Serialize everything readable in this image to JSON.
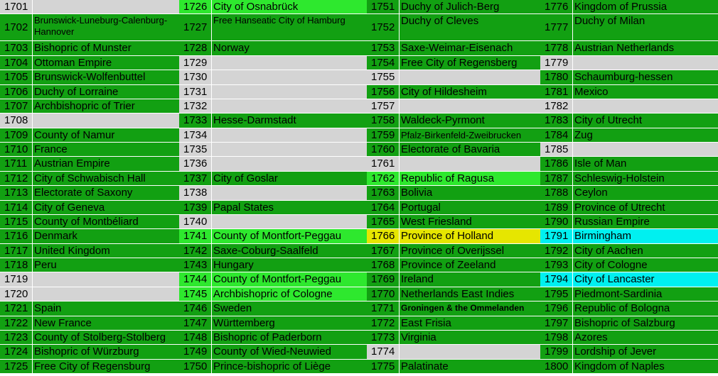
{
  "columns": [
    [
      {
        "num": "1701",
        "name": "",
        "color": "w"
      },
      {
        "num": "1702",
        "name": "Brunswick-Luneburg-Calenburg-Hannover",
        "color": "g",
        "tall": true
      },
      {
        "num": "1703",
        "name": "Bishopric of Munster",
        "color": "g"
      },
      {
        "num": "1704",
        "name": "Ottoman Empire",
        "color": "g"
      },
      {
        "num": "1705",
        "name": "Brunswick-Wolfenbuttel",
        "color": "g"
      },
      {
        "num": "1706",
        "name": "Duchy of Lorraine",
        "color": "g"
      },
      {
        "num": "1707",
        "name": "Archbishopric of Trier",
        "color": "g"
      },
      {
        "num": "1708",
        "name": "",
        "color": "w"
      },
      {
        "num": "1709",
        "name": "County of Namur",
        "color": "g"
      },
      {
        "num": "1710",
        "name": "France",
        "color": "g"
      },
      {
        "num": "1711",
        "name": "Austrian Empire",
        "color": "g"
      },
      {
        "num": "1712",
        "name": "City of Schwabisch Hall",
        "color": "g"
      },
      {
        "num": "1713",
        "name": "Electorate of Saxony",
        "color": "g"
      },
      {
        "num": "1714",
        "name": "City of Geneva",
        "color": "g"
      },
      {
        "num": "1715",
        "name": "County of Montbéliard",
        "color": "g"
      },
      {
        "num": "1716",
        "name": "Denmark",
        "color": "g"
      },
      {
        "num": "1717",
        "name": "United Kingdom",
        "color": "g"
      },
      {
        "num": "1718",
        "name": "Peru",
        "color": "g"
      },
      {
        "num": "1719",
        "name": "",
        "color": "w"
      },
      {
        "num": "1720",
        "name": "",
        "color": "w"
      },
      {
        "num": "1721",
        "name": "Spain",
        "color": "g"
      },
      {
        "num": "1722",
        "name": "New France",
        "color": "g"
      },
      {
        "num": "1723",
        "name": "County of Stolberg-Stolberg",
        "color": "g"
      },
      {
        "num": "1724",
        "name": "Bishopric of Würzburg",
        "color": "g"
      },
      {
        "num": "1725",
        "name": "Free City of Regensburg",
        "color": "g"
      }
    ],
    [
      {
        "num": "1726",
        "name": "City of Osnabrück",
        "color": "lg"
      },
      {
        "num": "1727",
        "name": "Free Hanseatic City of Hamburg",
        "color": "g",
        "tall": true
      },
      {
        "num": "1728",
        "name": "Norway",
        "color": "g"
      },
      {
        "num": "1729",
        "name": "",
        "color": "w"
      },
      {
        "num": "1730",
        "name": "",
        "color": "w"
      },
      {
        "num": "1731",
        "name": "",
        "color": "w"
      },
      {
        "num": "1732",
        "name": "",
        "color": "w"
      },
      {
        "num": "1733",
        "name": "Hesse-Darmstadt",
        "color": "g"
      },
      {
        "num": "1734",
        "name": "",
        "color": "w"
      },
      {
        "num": "1735",
        "name": "",
        "color": "w"
      },
      {
        "num": "1736",
        "name": "",
        "color": "w"
      },
      {
        "num": "1737",
        "name": "City of Goslar",
        "color": "g"
      },
      {
        "num": "1738",
        "name": "",
        "color": "w"
      },
      {
        "num": "1739",
        "name": "Papal States",
        "color": "g"
      },
      {
        "num": "1740",
        "name": "",
        "color": "w"
      },
      {
        "num": "1741",
        "name": "County of Montfort-Peggau",
        "color": "lg"
      },
      {
        "num": "1742",
        "name": "Saxe-Coburg-Saalfeld",
        "color": "g"
      },
      {
        "num": "1743",
        "name": "Hungary",
        "color": "g"
      },
      {
        "num": "1744",
        "name": "County of Montfort-Peggau",
        "color": "lg"
      },
      {
        "num": "1745",
        "name": "Archbishopric of Cologne",
        "color": "lg"
      },
      {
        "num": "1746",
        "name": "Sweden",
        "color": "g"
      },
      {
        "num": "1747",
        "name": "Württemberg",
        "color": "g"
      },
      {
        "num": "1748",
        "name": "Bishopric of Paderborn",
        "color": "g"
      },
      {
        "num": "1749",
        "name": "County of Wied-Neuwied",
        "color": "g"
      },
      {
        "num": "1750",
        "name": "Prince-bishopric of Liège",
        "color": "g"
      }
    ],
    [
      {
        "num": "1751",
        "name": "Duchy of Julich-Berg",
        "color": "g"
      },
      {
        "num": "1752",
        "name": "Duchy of Cleves",
        "color": "g",
        "tall": true
      },
      {
        "num": "1753",
        "name": "Saxe-Weimar-Eisenach",
        "color": "g"
      },
      {
        "num": "1754",
        "name": "Free City of Regensberg",
        "color": "g"
      },
      {
        "num": "1755",
        "name": "",
        "color": "w"
      },
      {
        "num": "1756",
        "name": "City of Hildesheim",
        "color": "g"
      },
      {
        "num": "1757",
        "name": "",
        "color": "w"
      },
      {
        "num": "1758",
        "name": "Waldeck-Pyrmont",
        "color": "g"
      },
      {
        "num": "1759",
        "name": "Pfalz-Birkenfeld-Zweibrucken",
        "color": "g",
        "tight": true
      },
      {
        "num": "1760",
        "name": "Electorate of Bavaria",
        "color": "g"
      },
      {
        "num": "1761",
        "name": "",
        "color": "w"
      },
      {
        "num": "1762",
        "name": "Republic of Ragusa",
        "color": "lg"
      },
      {
        "num": "1763",
        "name": "Bolivia",
        "color": "g"
      },
      {
        "num": "1764",
        "name": "Portugal",
        "color": "g"
      },
      {
        "num": "1765",
        "name": "West Friesland",
        "color": "g"
      },
      {
        "num": "1766",
        "name": "Province of Holland",
        "color": "y"
      },
      {
        "num": "1767",
        "name": "Province of Overijssel",
        "color": "g"
      },
      {
        "num": "1768",
        "name": "Province of Zeeland",
        "color": "g"
      },
      {
        "num": "1769",
        "name": "Ireland",
        "color": "g"
      },
      {
        "num": "1770",
        "name": "Netherlands East Indies",
        "color": "g"
      },
      {
        "num": "1771",
        "name": "Groningen & the Ommelanden",
        "color": "g",
        "small": true
      },
      {
        "num": "1772",
        "name": "East Frisia",
        "color": "g"
      },
      {
        "num": "1773",
        "name": "Virginia",
        "color": "g"
      },
      {
        "num": "1774",
        "name": "",
        "color": "w"
      },
      {
        "num": "1775",
        "name": "Palatinate",
        "color": "g"
      }
    ],
    [
      {
        "num": "1776",
        "name": "Kingdom of Prussia",
        "color": "g"
      },
      {
        "num": "1777",
        "name": "Duchy of Milan",
        "color": "g",
        "tall": true
      },
      {
        "num": "1778",
        "name": "Austrian Netherlands",
        "color": "g"
      },
      {
        "num": "1779",
        "name": "",
        "color": "w"
      },
      {
        "num": "1780",
        "name": "Schaumburg-hessen",
        "color": "g"
      },
      {
        "num": "1781",
        "name": "Mexico",
        "color": "g"
      },
      {
        "num": "1782",
        "name": "",
        "color": "w"
      },
      {
        "num": "1783",
        "name": "City of Utrecht",
        "color": "g"
      },
      {
        "num": "1784",
        "name": "Zug",
        "color": "g"
      },
      {
        "num": "1785",
        "name": "",
        "color": "w"
      },
      {
        "num": "1786",
        "name": "Isle of Man",
        "color": "g"
      },
      {
        "num": "1787",
        "name": "Schleswig-Holstein",
        "color": "g"
      },
      {
        "num": "1788",
        "name": "Ceylon",
        "color": "g"
      },
      {
        "num": "1789",
        "name": "Province of Utrecht",
        "color": "g"
      },
      {
        "num": "1790",
        "name": "Russian Empire",
        "color": "g"
      },
      {
        "num": "1791",
        "name": "Birmingham",
        "color": "c"
      },
      {
        "num": "1792",
        "name": "City of Aachen",
        "color": "g"
      },
      {
        "num": "1793",
        "name": "City of Cologne",
        "color": "g"
      },
      {
        "num": "1794",
        "name": "City of Lancaster",
        "color": "c"
      },
      {
        "num": "1795",
        "name": "Piedmont-Sardinia",
        "color": "g"
      },
      {
        "num": "1796",
        "name": "Republic of Bologna",
        "color": "g"
      },
      {
        "num": "1797",
        "name": "Bishopric of Salzburg",
        "color": "g"
      },
      {
        "num": "1798",
        "name": "Azores",
        "color": "g"
      },
      {
        "num": "1799",
        "name": "Lordship of Jever",
        "color": "g"
      },
      {
        "num": "1800",
        "name": "Kingdom of Naples",
        "color": "g"
      }
    ]
  ]
}
